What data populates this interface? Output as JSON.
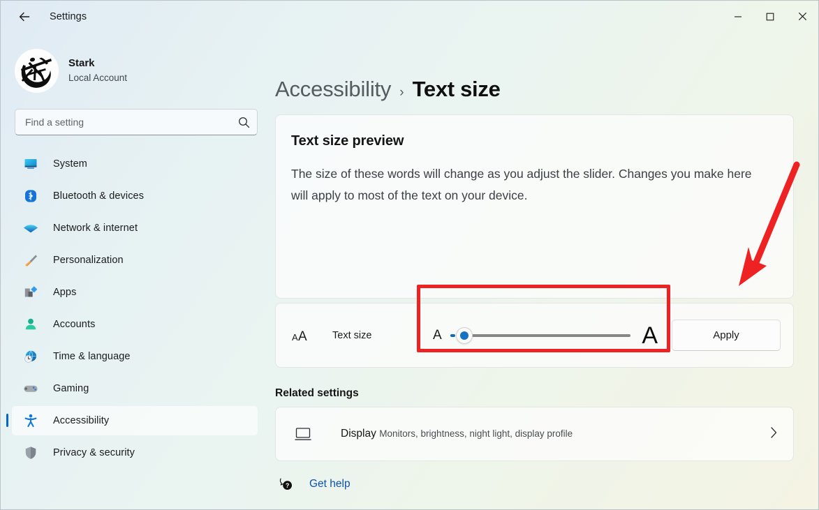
{
  "window": {
    "title": "Settings",
    "back_icon": "back-arrow-icon",
    "minimize_label": "Minimize",
    "maximize_label": "Maximize",
    "close_label": "Close"
  },
  "account": {
    "name": "Stark",
    "type": "Local Account"
  },
  "search": {
    "placeholder": "Find a setting",
    "value": "",
    "icon": "search-icon"
  },
  "sidebar": {
    "items": [
      {
        "label": "System",
        "icon": "system-icon",
        "selected": false
      },
      {
        "label": "Bluetooth & devices",
        "icon": "bluetooth-icon",
        "selected": false
      },
      {
        "label": "Network & internet",
        "icon": "wifi-icon",
        "selected": false
      },
      {
        "label": "Personalization",
        "icon": "paintbrush-icon",
        "selected": false
      },
      {
        "label": "Apps",
        "icon": "apps-icon",
        "selected": false
      },
      {
        "label": "Accounts",
        "icon": "person-icon",
        "selected": false
      },
      {
        "label": "Time & language",
        "icon": "clock-globe-icon",
        "selected": false
      },
      {
        "label": "Gaming",
        "icon": "gamepad-icon",
        "selected": false
      },
      {
        "label": "Accessibility",
        "icon": "accessibility-icon",
        "selected": true
      },
      {
        "label": "Privacy & security",
        "icon": "shield-icon",
        "selected": false
      }
    ]
  },
  "breadcrumb": {
    "parent": "Accessibility",
    "separator": "›",
    "current": "Text size"
  },
  "preview": {
    "title": "Text size preview",
    "body": "The size of these words will change as you adjust the slider. Changes you make here will apply to most of the text on your device."
  },
  "text_size_row": {
    "icon": "text-size-icon",
    "icon_small_glyph": "A",
    "icon_large_glyph": "A",
    "label": "Text size",
    "slider": {
      "min_glyph": "A",
      "max_glyph": "A",
      "value_percent": 8,
      "min": 100,
      "max": 225
    },
    "apply_label": "Apply"
  },
  "related": {
    "heading": "Related settings",
    "items": [
      {
        "title": "Display",
        "subtitle": "Monitors, brightness, night light, display profile",
        "icon": "monitor-icon",
        "chevron": "chevron-right-icon"
      }
    ]
  },
  "help": {
    "label": "Get help",
    "icon": "help-bubble-icon"
  },
  "annotations": {
    "highlight_color": "#ee2222",
    "arrow_color": "#ee2222",
    "highlight_target": "text-size-slider",
    "arrow_target": "text-size-slider"
  },
  "colors": {
    "accent": "#0f6cbd",
    "link": "#0d53a6",
    "selection_bar": "#0066cc"
  }
}
